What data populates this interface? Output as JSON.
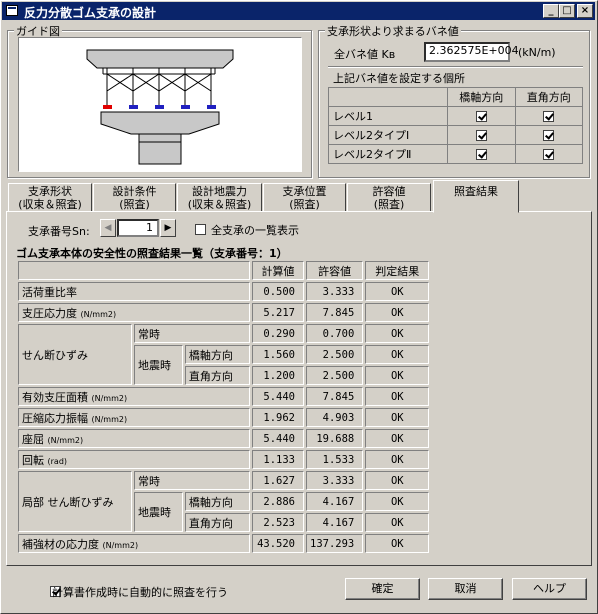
{
  "window": {
    "title": "反力分散ゴム支承の設計",
    "controls": [
      "_",
      "□",
      "×"
    ]
  },
  "guide": {
    "label": "ガイド図"
  },
  "spring": {
    "group_label": "支承形状より求まるバネ値",
    "total_label": "全バネ値 Kʙ",
    "total_value": "2.362575E+004",
    "unit": "(kN/m)",
    "sub_label": "上記バネ値を設定する個所",
    "col_headers": [
      "橋軸方向",
      "直角方向"
    ],
    "rows": [
      {
        "label": "レベル1",
        "bridge": true,
        "perp": true
      },
      {
        "label": "レベル2タイプⅠ",
        "bridge": true,
        "perp": true
      },
      {
        "label": "レベル2タイプⅡ",
        "bridge": true,
        "perp": true
      }
    ]
  },
  "tabs": [
    {
      "line1": "支承形状",
      "line2": "(収束＆照査)"
    },
    {
      "line1": "設計条件",
      "line2": "(照査)"
    },
    {
      "line1": "設計地震力",
      "line2": "(収束＆照査)"
    },
    {
      "line1": "支承位置",
      "line2": "(照査)"
    },
    {
      "line1": "許容値",
      "line2": "(照査)"
    },
    {
      "line1": "照査結果",
      "line2": ""
    }
  ],
  "bearing_no": {
    "label": "支承番号Sn:",
    "value": "1",
    "show_all_label": "全支承の一覧表示",
    "show_all": false
  },
  "results": {
    "title": "ゴム支承本体の安全性の照査結果一覧（支承番号：1）",
    "headers": [
      "計算値",
      "許容値",
      "判定結果"
    ],
    "unit": "(N/mm2)",
    "unit_rad": "(rad)",
    "labels": {
      "live": "活荷重比率",
      "bearing_stress": "支圧応力度",
      "shear": "せん断ひずみ",
      "normal": "常時",
      "seismic": "地震時",
      "bridge_dir": "橋軸方向",
      "perp_dir": "直角方向",
      "eff_area": "有効支圧面積",
      "comp_amp": "圧縮応力振幅",
      "buckling": "座屈",
      "rotation": "回転",
      "local_shear": "局部 せん断ひずみ",
      "reinf": "補強材の応力度"
    },
    "values": {
      "live": [
        "0.500",
        "3.333",
        "OK"
      ],
      "bearing_stress": [
        "5.217",
        "7.845",
        "OK"
      ],
      "shear_normal": [
        "0.290",
        "0.700",
        "OK"
      ],
      "shear_bridge": [
        "1.560",
        "2.500",
        "OK"
      ],
      "shear_perp": [
        "1.200",
        "2.500",
        "OK"
      ],
      "eff_area": [
        "5.440",
        "7.845",
        "OK"
      ],
      "comp_amp": [
        "1.962",
        "4.903",
        "OK"
      ],
      "buckling": [
        "5.440",
        "19.688",
        "OK"
      ],
      "rotation": [
        "1.133",
        "1.533",
        "OK"
      ],
      "local_normal": [
        "1.627",
        "3.333",
        "OK"
      ],
      "local_bridge": [
        "2.886",
        "4.167",
        "OK"
      ],
      "local_perp": [
        "2.523",
        "4.167",
        "OK"
      ],
      "reinf": [
        "43.520",
        "137.293",
        "OK"
      ]
    }
  },
  "footer": {
    "auto_check_label": "計算書作成時に自動的に照査を行う",
    "auto_check": true,
    "ok_label": "確定",
    "cancel_label": "取消",
    "help_label": "ヘルプ"
  }
}
